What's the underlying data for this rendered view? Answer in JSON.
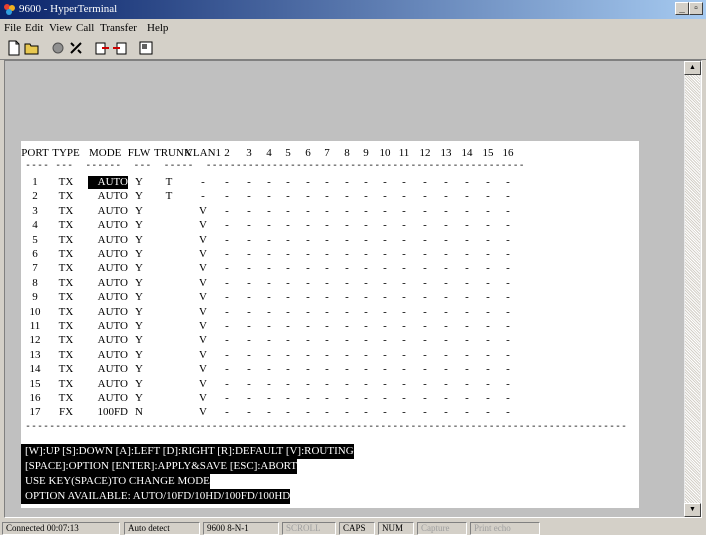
{
  "window": {
    "title": "9600 - HyperTerminal"
  },
  "menu": [
    "File",
    "Edit",
    "View",
    "Call",
    "Transfer",
    "Help"
  ],
  "toolbar": [
    "new-icon",
    "open-icon",
    "disconnect-icon",
    "dial-icon",
    "send-icon",
    "receive-icon",
    "properties-icon"
  ],
  "table": {
    "headers": [
      "PORT",
      "TYPE",
      "MODE",
      "FLW",
      "TRUNK",
      "VLAN1",
      "2",
      "3",
      "4",
      "5",
      "6",
      "7",
      "8",
      "9",
      "10",
      "11",
      "12",
      "13",
      "14",
      "15",
      "16"
    ],
    "rows": [
      {
        "port": "1",
        "type": "TX",
        "mode": "AUTO",
        "flw": "Y",
        "trunk": "T",
        "vlan": "-",
        "selected": true
      },
      {
        "port": "2",
        "type": "TX",
        "mode": "AUTO",
        "flw": "Y",
        "trunk": "T",
        "vlan": "-"
      },
      {
        "port": "3",
        "type": "TX",
        "mode": "AUTO",
        "flw": "Y",
        "trunk": "",
        "vlan": "V"
      },
      {
        "port": "4",
        "type": "TX",
        "mode": "AUTO",
        "flw": "Y",
        "trunk": "",
        "vlan": "V"
      },
      {
        "port": "5",
        "type": "TX",
        "mode": "AUTO",
        "flw": "Y",
        "trunk": "",
        "vlan": "V"
      },
      {
        "port": "6",
        "type": "TX",
        "mode": "AUTO",
        "flw": "Y",
        "trunk": "",
        "vlan": "V"
      },
      {
        "port": "7",
        "type": "TX",
        "mode": "AUTO",
        "flw": "Y",
        "trunk": "",
        "vlan": "V"
      },
      {
        "port": "8",
        "type": "TX",
        "mode": "AUTO",
        "flw": "Y",
        "trunk": "",
        "vlan": "V"
      },
      {
        "port": "9",
        "type": "TX",
        "mode": "AUTO",
        "flw": "Y",
        "trunk": "",
        "vlan": "V"
      },
      {
        "port": "10",
        "type": "TX",
        "mode": "AUTO",
        "flw": "Y",
        "trunk": "",
        "vlan": "V"
      },
      {
        "port": "11",
        "type": "TX",
        "mode": "AUTO",
        "flw": "Y",
        "trunk": "",
        "vlan": "V"
      },
      {
        "port": "12",
        "type": "TX",
        "mode": "AUTO",
        "flw": "Y",
        "trunk": "",
        "vlan": "V"
      },
      {
        "port": "13",
        "type": "TX",
        "mode": "AUTO",
        "flw": "Y",
        "trunk": "",
        "vlan": "V"
      },
      {
        "port": "14",
        "type": "TX",
        "mode": "AUTO",
        "flw": "Y",
        "trunk": "",
        "vlan": "V"
      },
      {
        "port": "15",
        "type": "TX",
        "mode": "AUTO",
        "flw": "Y",
        "trunk": "",
        "vlan": "V"
      },
      {
        "port": "16",
        "type": "TX",
        "mode": "AUTO",
        "flw": "Y",
        "trunk": "",
        "vlan": "V"
      },
      {
        "port": "17",
        "type": "FX",
        "mode": "100FD",
        "flw": "N",
        "trunk": "",
        "vlan": "V"
      }
    ],
    "empty_vlan": "-"
  },
  "help": {
    "line1": "[W]:UP [S]:DOWN [A]:LEFT [D]:RIGHT [R]:DEFAULT [V]:ROUTING",
    "line2": "[SPACE]:OPTION [ENTER]:APPLY&SAVE [ESC]:ABORT",
    "line3": "USE KEY(SPACE)TO CHANGE MODE",
    "line4": "OPTION AVAILABLE: AUTO/10FD/10HD/100FD/100HD"
  },
  "status": {
    "connected": "Connected 00:07:13",
    "detect": "Auto detect",
    "params": "9600 8-N-1",
    "scroll": "SCROLL",
    "caps": "CAPS",
    "num": "NUM",
    "capture": "Capture",
    "printecho": "Print echo"
  }
}
